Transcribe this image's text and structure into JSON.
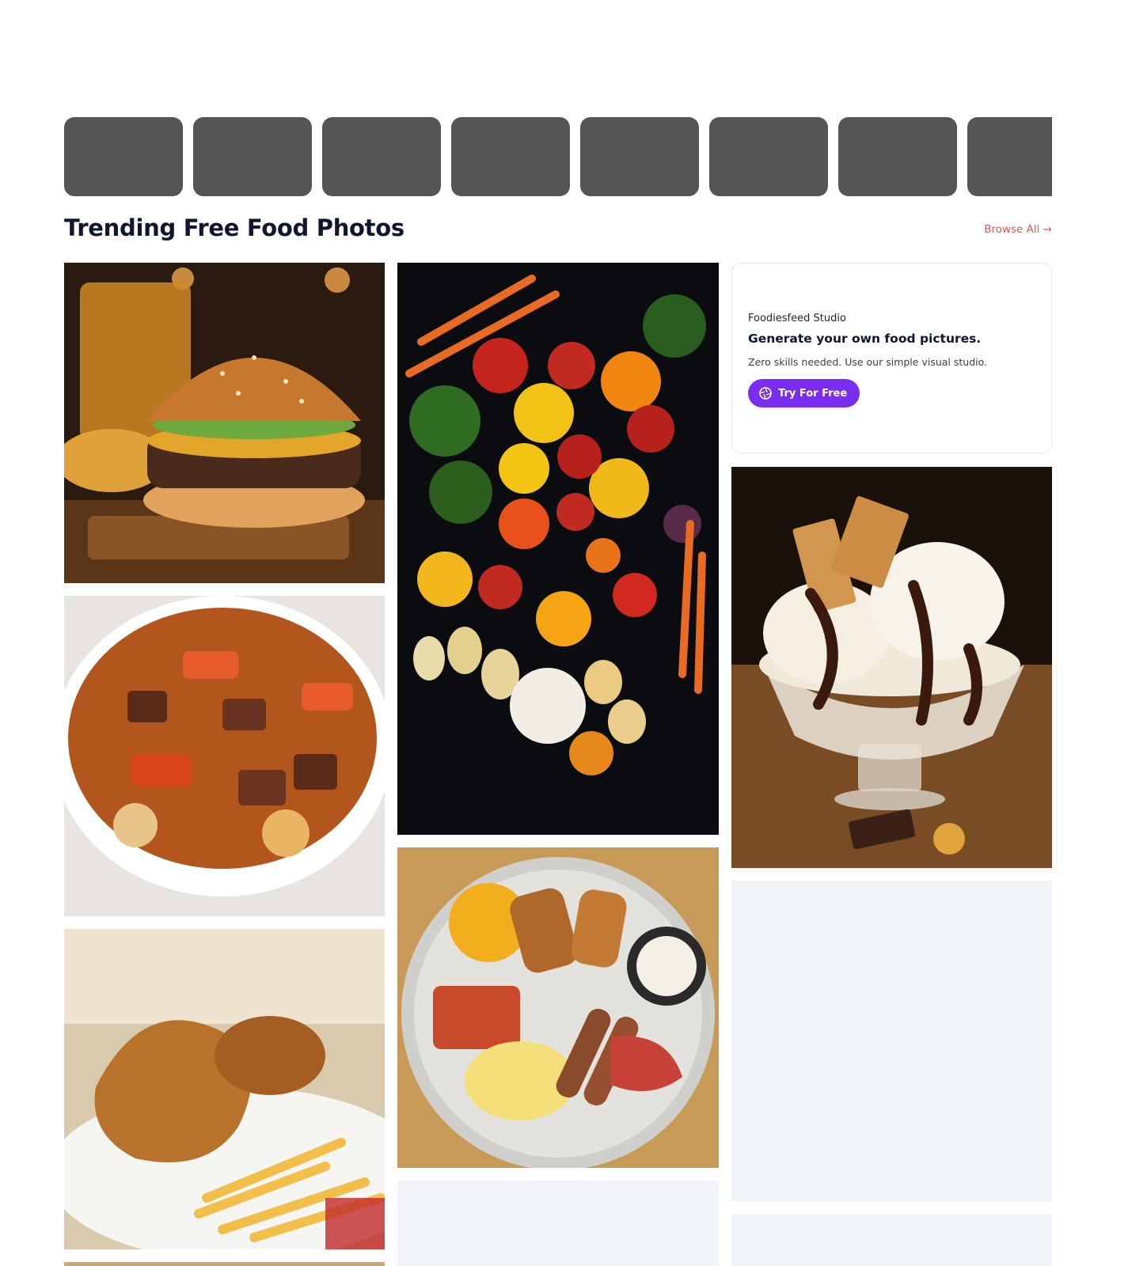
{
  "categories": {
    "pills": [
      "",
      "",
      "",
      "",
      "",
      "",
      "",
      ""
    ]
  },
  "section": {
    "title": "Trending Free Food Photos",
    "browse_all": "Browse All →"
  },
  "promo": {
    "brand": "Foodiesfeed Studio",
    "headline": "Generate your own food pictures.",
    "subtext": "Zero skills needed. Use our simple visual studio.",
    "button_label": "Try For Free",
    "button_icon": "aperture-icon",
    "accent_color": "#7a2df0"
  },
  "photos": [
    {
      "subject": "burger"
    },
    {
      "subject": "vegetables"
    },
    {
      "subject": "ice-cream"
    },
    {
      "subject": "beef-stew"
    },
    {
      "subject": "breakfast-plate"
    },
    {
      "subject": "fried-chicken"
    }
  ],
  "colors": {
    "pill": "#545556",
    "title": "#0e1630",
    "link": "#d25b50",
    "placeholder": "#f0f3f8"
  }
}
